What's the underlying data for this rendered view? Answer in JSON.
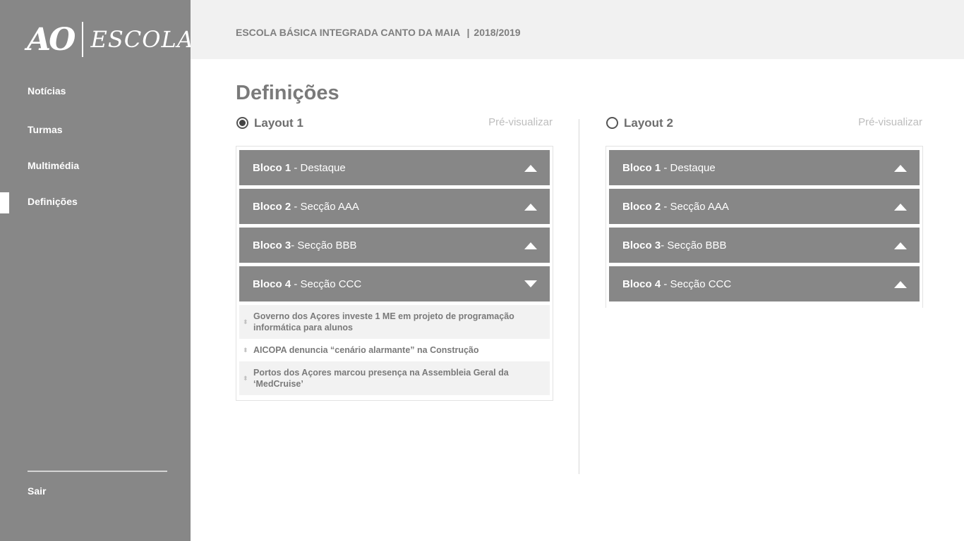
{
  "sidebar": {
    "logo": {
      "mark": "AO",
      "text": "ESCOLAS"
    },
    "nav": [
      {
        "label": "Notícias"
      },
      {
        "label": "Turmas"
      },
      {
        "label": "Multimédia"
      },
      {
        "label": "Definições",
        "active": true
      }
    ],
    "logout": "Sair"
  },
  "header": {
    "school": "ESCOLA BÁSICA INTEGRADA CANTO DA MAIA",
    "separator": "|",
    "year": "2018/2019"
  },
  "page": {
    "title": "Definições"
  },
  "layouts": [
    {
      "label": "Layout 1",
      "selected": true,
      "preview_label": "Pré-visualizar",
      "blocks": [
        {
          "name": "Bloco 1",
          "desc": " - Destaque",
          "expanded": false
        },
        {
          "name": "Bloco 2",
          "desc": " - Secção AAA",
          "expanded": false
        },
        {
          "name": "Bloco 3",
          "desc": "- Secção BBB",
          "expanded": false
        },
        {
          "name": "Bloco 4",
          "desc": " - Secção CCC",
          "expanded": true
        }
      ],
      "news": [
        "Governo dos Açores investe 1 ME em projeto de programação informática para alunos",
        "AICOPA denuncia “cenário alarmante” na Construção",
        "Portos dos Açores marcou presença na Assembleia Geral da ‘MedCruise’"
      ]
    },
    {
      "label": "Layout 2",
      "selected": false,
      "preview_label": "Pré-visualizar",
      "blocks": [
        {
          "name": "Bloco 1",
          "desc": " - Destaque",
          "expanded": false
        },
        {
          "name": "Bloco 2",
          "desc": " - Secção AAA",
          "expanded": false
        },
        {
          "name": "Bloco 3",
          "desc": "- Secção BBB",
          "expanded": false
        },
        {
          "name": "Bloco 4",
          "desc": " - Secção CCC",
          "expanded": false
        }
      ]
    }
  ],
  "colors": {
    "sidebar_bg": "#878787",
    "header_bg": "#f1f1f1",
    "block_bg": "#878787",
    "muted_text": "#7a7a7a",
    "preview_link": "#bdbdbd"
  },
  "icons": {
    "collapsed": "chevron-up-icon",
    "expanded": "chevron-down-icon",
    "drag": "drag-handle-icon"
  }
}
